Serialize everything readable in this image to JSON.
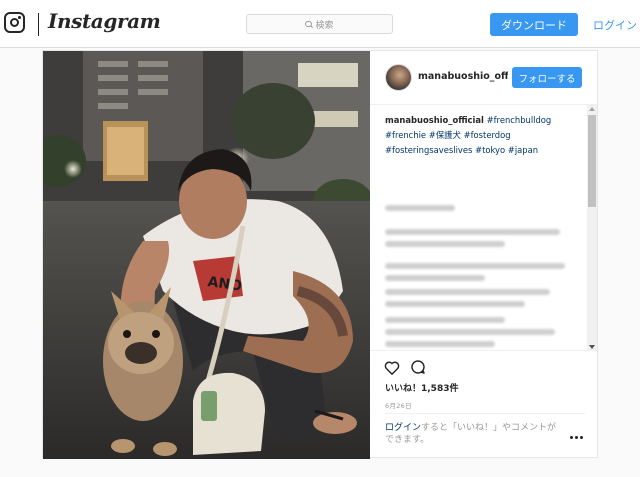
{
  "nav": {
    "brand": "Instagram",
    "search_placeholder": "検索",
    "download_label": "ダウンロード",
    "login_label": "ログイン"
  },
  "post": {
    "username": "manabuoshio_offi",
    "follow_label": "フォローする",
    "caption_username": "manabuoshio_official",
    "caption_tags": [
      "#frenchbulldog",
      "#frenchie",
      "#保護犬",
      "#fosterdog",
      "#fosteringsaveslives",
      "#tokyo",
      "#japan"
    ],
    "likes_text": "いいね！1,583件",
    "timestamp": "6月26日",
    "login_prompt_link": "ログイン",
    "login_prompt_rest": "すると「いいね！」やコメントができます。"
  },
  "icons": {
    "heart": "heart-icon",
    "comment": "comment-bubble-icon",
    "more": "more-options-icon",
    "search": "search-icon",
    "logo": "instagram-camera-icon"
  },
  "colors": {
    "accent": "#3897f0",
    "link": "#003569",
    "muted": "#999999"
  }
}
